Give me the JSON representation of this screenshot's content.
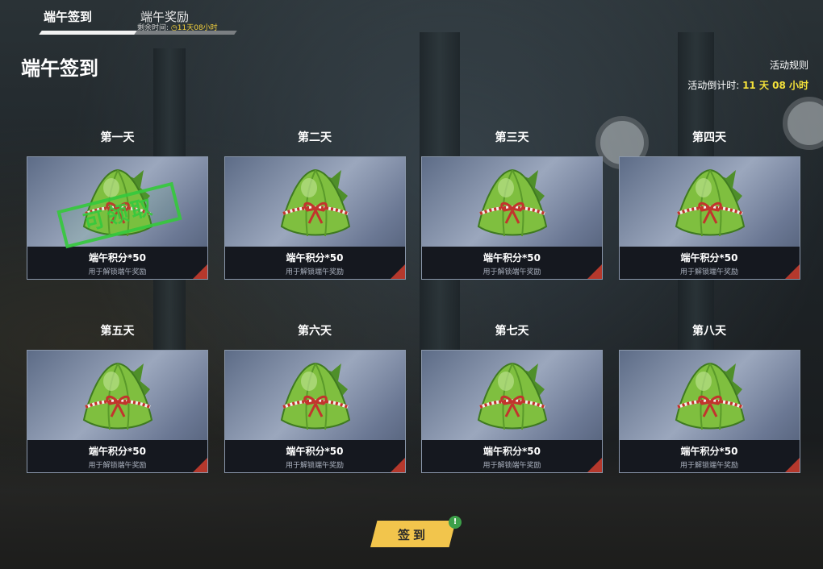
{
  "tabs": [
    {
      "label": "端午签到",
      "active": true
    },
    {
      "label": "端午奖励",
      "sub_prefix": "剩余时间: ",
      "sub_time": "◷11天08小时"
    }
  ],
  "page_title": "端午签到",
  "rules_label": "活动规则",
  "countdown": {
    "label": "活动倒计时:",
    "value": "11 天 08 小时"
  },
  "days": [
    {
      "title": "第一天",
      "reward": "端午积分*50",
      "desc": "用于解锁端午奖励",
      "stamp": "可领取"
    },
    {
      "title": "第二天",
      "reward": "端午积分*50",
      "desc": "用于解锁端午奖励"
    },
    {
      "title": "第三天",
      "reward": "端午积分*50",
      "desc": "用于解锁端午奖励"
    },
    {
      "title": "第四天",
      "reward": "端午积分*50",
      "desc": "用于解锁端午奖励"
    },
    {
      "title": "第五天",
      "reward": "端午积分*50",
      "desc": "用于解锁端午奖励"
    },
    {
      "title": "第六天",
      "reward": "端午积分*50",
      "desc": "用于解锁端午奖励"
    },
    {
      "title": "第七天",
      "reward": "端午积分*50",
      "desc": "用于解锁端午奖励"
    },
    {
      "title": "第八天",
      "reward": "端午积分*50",
      "desc": "用于解锁端午奖励"
    }
  ],
  "sign_button": {
    "label": "签到",
    "badge": "!"
  },
  "colors": {
    "accent": "#f2c54c",
    "countdown": "#f5e23a",
    "stamp": "#36c93d",
    "corner": "#b5382c"
  },
  "icons": {
    "reward": "zongzi-icon",
    "rules": "none"
  }
}
